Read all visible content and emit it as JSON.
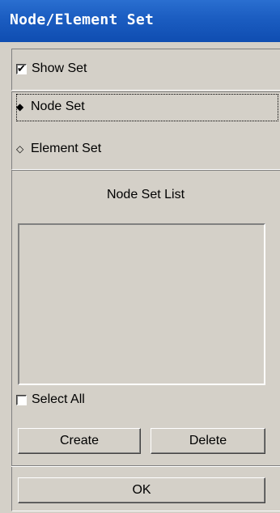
{
  "window": {
    "title": "Node/Element Set"
  },
  "show_set": {
    "label": "Show Set",
    "checked": true
  },
  "set_type": {
    "options": [
      {
        "label": "Node Set",
        "selected": true
      },
      {
        "label": "Element Set",
        "selected": false
      }
    ]
  },
  "list": {
    "header": "Node Set List",
    "items": []
  },
  "select_all": {
    "label": "Select All",
    "checked": false
  },
  "buttons": {
    "create": "Create",
    "delete": "Delete",
    "ok": "OK"
  },
  "icons": {
    "radio_selected": "◆",
    "radio_unselected": "◇",
    "check": "✔"
  }
}
